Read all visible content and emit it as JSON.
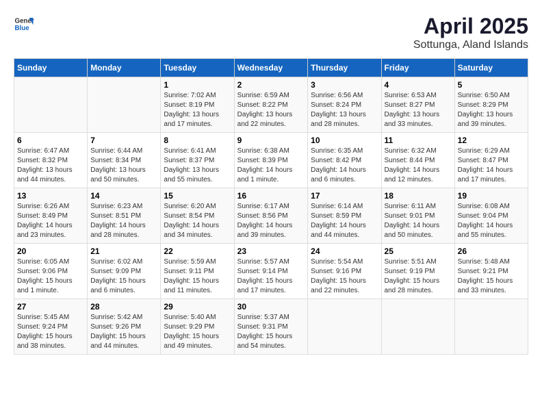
{
  "header": {
    "logo_general": "General",
    "logo_blue": "Blue",
    "month": "April 2025",
    "location": "Sottunga, Aland Islands"
  },
  "weekdays": [
    "Sunday",
    "Monday",
    "Tuesday",
    "Wednesday",
    "Thursday",
    "Friday",
    "Saturday"
  ],
  "weeks": [
    [
      {
        "day": "",
        "info": ""
      },
      {
        "day": "",
        "info": ""
      },
      {
        "day": "1",
        "info": "Sunrise: 7:02 AM\nSunset: 8:19 PM\nDaylight: 13 hours and 17 minutes."
      },
      {
        "day": "2",
        "info": "Sunrise: 6:59 AM\nSunset: 8:22 PM\nDaylight: 13 hours and 22 minutes."
      },
      {
        "day": "3",
        "info": "Sunrise: 6:56 AM\nSunset: 8:24 PM\nDaylight: 13 hours and 28 minutes."
      },
      {
        "day": "4",
        "info": "Sunrise: 6:53 AM\nSunset: 8:27 PM\nDaylight: 13 hours and 33 minutes."
      },
      {
        "day": "5",
        "info": "Sunrise: 6:50 AM\nSunset: 8:29 PM\nDaylight: 13 hours and 39 minutes."
      }
    ],
    [
      {
        "day": "6",
        "info": "Sunrise: 6:47 AM\nSunset: 8:32 PM\nDaylight: 13 hours and 44 minutes."
      },
      {
        "day": "7",
        "info": "Sunrise: 6:44 AM\nSunset: 8:34 PM\nDaylight: 13 hours and 50 minutes."
      },
      {
        "day": "8",
        "info": "Sunrise: 6:41 AM\nSunset: 8:37 PM\nDaylight: 13 hours and 55 minutes."
      },
      {
        "day": "9",
        "info": "Sunrise: 6:38 AM\nSunset: 8:39 PM\nDaylight: 14 hours and 1 minute."
      },
      {
        "day": "10",
        "info": "Sunrise: 6:35 AM\nSunset: 8:42 PM\nDaylight: 14 hours and 6 minutes."
      },
      {
        "day": "11",
        "info": "Sunrise: 6:32 AM\nSunset: 8:44 PM\nDaylight: 14 hours and 12 minutes."
      },
      {
        "day": "12",
        "info": "Sunrise: 6:29 AM\nSunset: 8:47 PM\nDaylight: 14 hours and 17 minutes."
      }
    ],
    [
      {
        "day": "13",
        "info": "Sunrise: 6:26 AM\nSunset: 8:49 PM\nDaylight: 14 hours and 23 minutes."
      },
      {
        "day": "14",
        "info": "Sunrise: 6:23 AM\nSunset: 8:51 PM\nDaylight: 14 hours and 28 minutes."
      },
      {
        "day": "15",
        "info": "Sunrise: 6:20 AM\nSunset: 8:54 PM\nDaylight: 14 hours and 34 minutes."
      },
      {
        "day": "16",
        "info": "Sunrise: 6:17 AM\nSunset: 8:56 PM\nDaylight: 14 hours and 39 minutes."
      },
      {
        "day": "17",
        "info": "Sunrise: 6:14 AM\nSunset: 8:59 PM\nDaylight: 14 hours and 44 minutes."
      },
      {
        "day": "18",
        "info": "Sunrise: 6:11 AM\nSunset: 9:01 PM\nDaylight: 14 hours and 50 minutes."
      },
      {
        "day": "19",
        "info": "Sunrise: 6:08 AM\nSunset: 9:04 PM\nDaylight: 14 hours and 55 minutes."
      }
    ],
    [
      {
        "day": "20",
        "info": "Sunrise: 6:05 AM\nSunset: 9:06 PM\nDaylight: 15 hours and 1 minute."
      },
      {
        "day": "21",
        "info": "Sunrise: 6:02 AM\nSunset: 9:09 PM\nDaylight: 15 hours and 6 minutes."
      },
      {
        "day": "22",
        "info": "Sunrise: 5:59 AM\nSunset: 9:11 PM\nDaylight: 15 hours and 11 minutes."
      },
      {
        "day": "23",
        "info": "Sunrise: 5:57 AM\nSunset: 9:14 PM\nDaylight: 15 hours and 17 minutes."
      },
      {
        "day": "24",
        "info": "Sunrise: 5:54 AM\nSunset: 9:16 PM\nDaylight: 15 hours and 22 minutes."
      },
      {
        "day": "25",
        "info": "Sunrise: 5:51 AM\nSunset: 9:19 PM\nDaylight: 15 hours and 28 minutes."
      },
      {
        "day": "26",
        "info": "Sunrise: 5:48 AM\nSunset: 9:21 PM\nDaylight: 15 hours and 33 minutes."
      }
    ],
    [
      {
        "day": "27",
        "info": "Sunrise: 5:45 AM\nSunset: 9:24 PM\nDaylight: 15 hours and 38 minutes."
      },
      {
        "day": "28",
        "info": "Sunrise: 5:42 AM\nSunset: 9:26 PM\nDaylight: 15 hours and 44 minutes."
      },
      {
        "day": "29",
        "info": "Sunrise: 5:40 AM\nSunset: 9:29 PM\nDaylight: 15 hours and 49 minutes."
      },
      {
        "day": "30",
        "info": "Sunrise: 5:37 AM\nSunset: 9:31 PM\nDaylight: 15 hours and 54 minutes."
      },
      {
        "day": "",
        "info": ""
      },
      {
        "day": "",
        "info": ""
      },
      {
        "day": "",
        "info": ""
      }
    ]
  ]
}
